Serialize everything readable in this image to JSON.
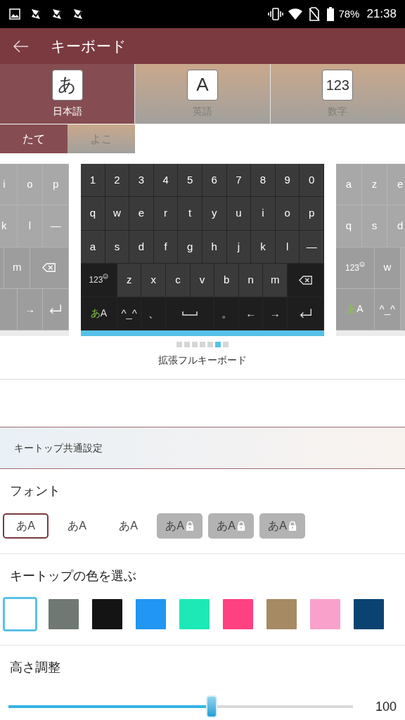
{
  "status_bar": {
    "battery": "78%",
    "time": "21:38"
  },
  "app_bar": {
    "title": "キーボード"
  },
  "tabs": [
    {
      "glyph": "あ",
      "label": "日本語",
      "selected": true
    },
    {
      "glyph": "A",
      "label": "英語",
      "selected": false
    },
    {
      "glyph": "123",
      "label": "数字",
      "selected": false
    }
  ],
  "sub_tabs": [
    {
      "label": "たて",
      "selected": true
    },
    {
      "label": "よこ",
      "selected": false
    }
  ],
  "left_preview": [
    [
      {
        "kind": "char",
        "label": "i"
      },
      {
        "kind": "char",
        "label": "o"
      },
      {
        "kind": "char",
        "label": "p"
      }
    ],
    [
      {
        "kind": "char",
        "label": "k"
      },
      {
        "kind": "char",
        "label": "l"
      },
      {
        "kind": "char",
        "label": "—"
      }
    ],
    [
      {
        "kind": "blank"
      },
      {
        "kind": "char",
        "label": "m"
      },
      {
        "kind": "backspace"
      }
    ],
    [
      {
        "kind": "blank"
      },
      {
        "kind": "char",
        "label": "→"
      },
      {
        "kind": "enter"
      }
    ]
  ],
  "keyboard": [
    [
      {
        "kind": "char",
        "label": "1",
        "dark": false
      },
      {
        "kind": "char",
        "label": "2",
        "dark": false
      },
      {
        "kind": "char",
        "label": "3",
        "dark": false
      },
      {
        "kind": "char",
        "label": "4",
        "dark": false
      },
      {
        "kind": "char",
        "label": "5",
        "dark": false
      },
      {
        "kind": "char",
        "label": "6",
        "dark": false
      },
      {
        "kind": "char",
        "label": "7",
        "dark": false
      },
      {
        "kind": "char",
        "label": "8",
        "dark": false
      },
      {
        "kind": "char",
        "label": "9",
        "dark": false
      },
      {
        "kind": "char",
        "label": "0",
        "dark": false
      }
    ],
    [
      {
        "kind": "char",
        "label": "q",
        "dark": false
      },
      {
        "kind": "char",
        "label": "w",
        "dark": false
      },
      {
        "kind": "char",
        "label": "e",
        "dark": false
      },
      {
        "kind": "char",
        "label": "r",
        "dark": false
      },
      {
        "kind": "char",
        "label": "t",
        "dark": false
      },
      {
        "kind": "char",
        "label": "y",
        "dark": false
      },
      {
        "kind": "char",
        "label": "u",
        "dark": false
      },
      {
        "kind": "char",
        "label": "i",
        "dark": false
      },
      {
        "kind": "char",
        "label": "o",
        "dark": false
      },
      {
        "kind": "char",
        "label": "p",
        "dark": false
      }
    ],
    [
      {
        "kind": "char",
        "label": "a",
        "dark": false
      },
      {
        "kind": "char",
        "label": "s",
        "dark": false
      },
      {
        "kind": "char",
        "label": "d",
        "dark": false
      },
      {
        "kind": "char",
        "label": "f",
        "dark": false
      },
      {
        "kind": "char",
        "label": "g",
        "dark": false
      },
      {
        "kind": "char",
        "label": "h",
        "dark": false
      },
      {
        "kind": "char",
        "label": "j",
        "dark": false
      },
      {
        "kind": "char",
        "label": "k",
        "dark": false
      },
      {
        "kind": "char",
        "label": "l",
        "dark": false
      },
      {
        "kind": "char",
        "label": "—",
        "dark": false
      }
    ],
    [
      {
        "kind": "mode",
        "label": "123",
        "dark": true
      },
      {
        "kind": "char",
        "label": "z",
        "dark": false
      },
      {
        "kind": "char",
        "label": "x",
        "dark": false
      },
      {
        "kind": "char",
        "label": "c",
        "dark": false
      },
      {
        "kind": "char",
        "label": "v",
        "dark": false
      },
      {
        "kind": "char",
        "label": "b",
        "dark": false
      },
      {
        "kind": "char",
        "label": "n",
        "dark": false
      },
      {
        "kind": "char",
        "label": "m",
        "dark": false
      },
      {
        "kind": "backspace",
        "dark": true
      }
    ],
    [
      {
        "kind": "lang",
        "kana": "あ",
        "latin": "A",
        "dark": true
      },
      {
        "kind": "char",
        "label": "^_^",
        "dark": true
      },
      {
        "kind": "char",
        "label": "、",
        "dark": true
      },
      {
        "kind": "space",
        "dark": true
      },
      {
        "kind": "char",
        "label": "。",
        "dark": true
      },
      {
        "kind": "char",
        "label": "←",
        "dark": true
      },
      {
        "kind": "char",
        "label": "→",
        "dark": true
      },
      {
        "kind": "enter",
        "dark": true
      }
    ]
  ],
  "right_preview": [
    [
      {
        "kind": "char",
        "label": "a"
      },
      {
        "kind": "char",
        "label": "z"
      },
      {
        "kind": "char",
        "label": "e"
      }
    ],
    [
      {
        "kind": "char",
        "label": "q"
      },
      {
        "kind": "char",
        "label": "s"
      },
      {
        "kind": "char",
        "label": "d"
      }
    ],
    [
      {
        "kind": "mode",
        "label": "123"
      },
      {
        "kind": "char",
        "label": "w"
      }
    ],
    [
      {
        "kind": "lang",
        "kana": "あ",
        "latin": "A"
      },
      {
        "kind": "char",
        "label": "^_^"
      }
    ]
  ],
  "page_dots": [
    {
      "selected": false
    },
    {
      "selected": false
    },
    {
      "selected": false
    },
    {
      "selected": false
    },
    {
      "selected": false
    },
    {
      "selected": true
    },
    {
      "selected": false
    }
  ],
  "keyboard_name": "拡張フルキーボード",
  "section_header": "キートップ共通設定",
  "font": {
    "title": "フォント",
    "options": [
      {
        "label": "あA",
        "selected": true,
        "locked": false
      },
      {
        "label": "あA",
        "selected": false,
        "locked": false
      },
      {
        "label": "あA",
        "selected": false,
        "locked": false
      },
      {
        "label": "あA",
        "selected": false,
        "locked": true
      },
      {
        "label": "あA",
        "selected": false,
        "locked": true
      },
      {
        "label": "あA",
        "selected": false,
        "locked": true
      }
    ]
  },
  "key_color": {
    "title": "キートップの色を選ぶ",
    "swatches": [
      {
        "color": "#ffffff",
        "selected": true
      },
      {
        "color": "#6f7873",
        "selected": false
      },
      {
        "color": "#141414",
        "selected": false
      },
      {
        "color": "#2196f3",
        "selected": false
      },
      {
        "color": "#1de9b6",
        "selected": false
      },
      {
        "color": "#ff4081",
        "selected": false
      },
      {
        "color": "#a68a64",
        "selected": false
      },
      {
        "color": "#f9a1cb",
        "selected": false
      },
      {
        "color": "#0a4372",
        "selected": false
      }
    ]
  },
  "height": {
    "title": "高さ調整",
    "level": 0.59,
    "reading": "100"
  }
}
